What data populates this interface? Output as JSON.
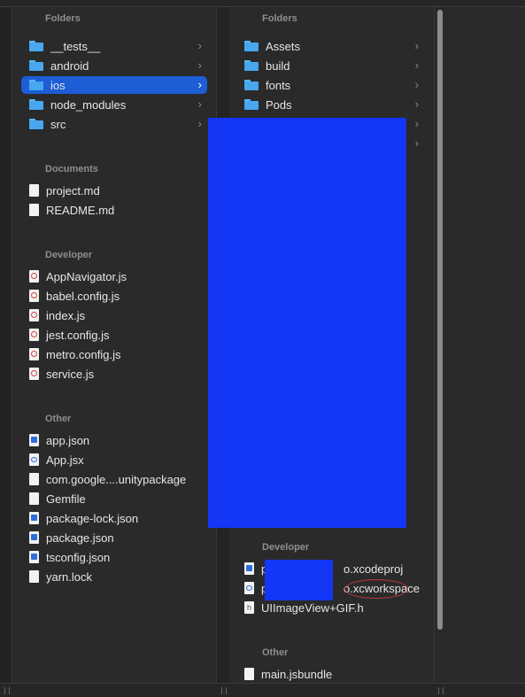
{
  "left_column": {
    "folders_title": "Folders",
    "folders": [
      {
        "label": "__tests__",
        "icon": "folder-icon"
      },
      {
        "label": "android",
        "icon": "folder-icon"
      },
      {
        "label": "ios",
        "icon": "folder-icon",
        "selected": true
      },
      {
        "label": "node_modules",
        "icon": "folder-icon"
      },
      {
        "label": "src",
        "icon": "folder-icon"
      }
    ],
    "documents_title": "Documents",
    "documents": [
      {
        "label": "project.md",
        "icon": "markdown-file-icon"
      },
      {
        "label": "README.md",
        "icon": "markdown-file-icon"
      }
    ],
    "developer_title": "Developer",
    "developer": [
      {
        "label": "AppNavigator.js",
        "icon": "js-file-icon"
      },
      {
        "label": "babel.config.js",
        "icon": "js-file-icon"
      },
      {
        "label": "index.js",
        "icon": "js-file-icon"
      },
      {
        "label": "jest.config.js",
        "icon": "js-file-icon"
      },
      {
        "label": "metro.config.js",
        "icon": "js-file-icon"
      },
      {
        "label": "service.js",
        "icon": "js-file-icon"
      }
    ],
    "other_title": "Other",
    "other": [
      {
        "label": "app.json",
        "icon": "json-file-icon"
      },
      {
        "label": "App.jsx",
        "icon": "jsx-file-icon"
      },
      {
        "label": "com.google....unitypackage",
        "icon": "generic-file-icon"
      },
      {
        "label": "Gemfile",
        "icon": "generic-file-icon"
      },
      {
        "label": "package-lock.json",
        "icon": "json-file-icon"
      },
      {
        "label": "package.json",
        "icon": "json-file-icon"
      },
      {
        "label": "tsconfig.json",
        "icon": "json-file-icon"
      },
      {
        "label": "yarn.lock",
        "icon": "generic-file-icon"
      }
    ]
  },
  "right_column": {
    "folders_title": "Folders",
    "folders": [
      {
        "label": "Assets",
        "icon": "folder-icon"
      },
      {
        "label": "build",
        "icon": "folder-icon"
      },
      {
        "label": "fonts",
        "icon": "folder-icon"
      },
      {
        "label": "Pods",
        "icon": "folder-icon"
      }
    ],
    "developer_title": "Developer",
    "developer": [
      {
        "label": "p",
        "suffix": "o.xcodeproj",
        "icon": "xcodeproj-icon"
      },
      {
        "label": "p",
        "suffix": "o.xcworkspace",
        "icon": "xcworkspace-icon"
      },
      {
        "label": "UIImageView+GIF.h",
        "icon": "header-file-icon"
      }
    ],
    "other_title": "Other",
    "other": [
      {
        "label": "main.jsbundle",
        "icon": "generic-file-icon"
      }
    ]
  },
  "chevron": "›",
  "colors": {
    "selection": "#1d5dd6",
    "redaction": "#1436f5",
    "annotation": "#c73a3a"
  }
}
